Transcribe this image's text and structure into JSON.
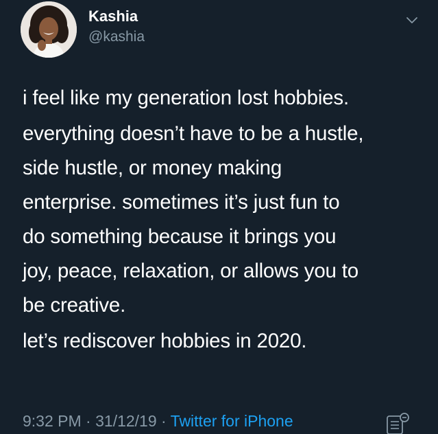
{
  "user": {
    "display_name": "Kashia",
    "handle": "@kashia"
  },
  "tweet": {
    "paragraphs": [
      [
        "i feel like my generation lost hobbies."
      ],
      [
        "everything doesn’t have to be a hustle,",
        "side hustle, or money making",
        "enterprise. sometimes it’s just fun to",
        "do something because it brings you",
        "joy, peace, relaxation, or allows you to",
        "be creative."
      ],
      [
        "let’s rediscover hobbies in 2020."
      ]
    ]
  },
  "meta": {
    "time": "9:32 PM",
    "separator": " · ",
    "date": "31/12/19",
    "source": "Twitter for iPhone"
  },
  "icons": {
    "menu": "chevron-down-icon",
    "analytics": "analytics-icon"
  },
  "colors": {
    "background": "#15202b",
    "text": "#ffffff",
    "secondary": "#8899a6",
    "link": "#1da1f2"
  }
}
